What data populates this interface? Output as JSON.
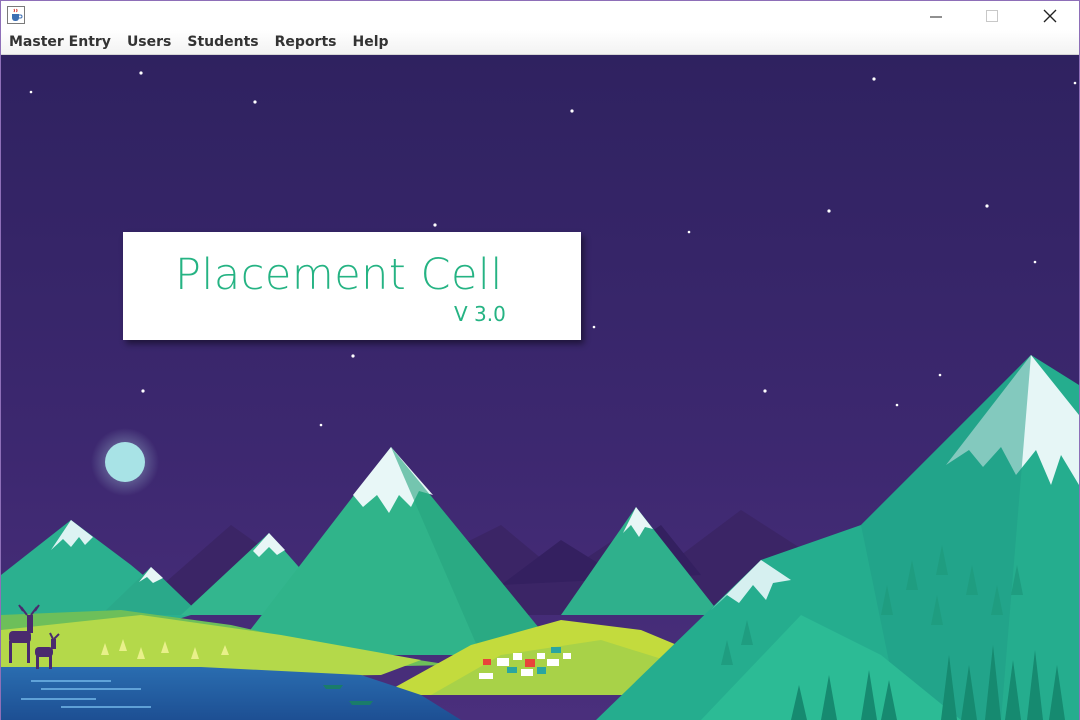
{
  "window": {
    "icon": "java-cup-icon",
    "controls": {
      "minimize": "minimize-icon",
      "maximize": "maximize-icon",
      "close": "close-icon"
    }
  },
  "menubar": {
    "items": [
      {
        "label": "Master Entry"
      },
      {
        "label": "Users"
      },
      {
        "label": "Students"
      },
      {
        "label": "Reports"
      },
      {
        "label": "Help"
      }
    ]
  },
  "splash": {
    "title": "Placement Cell",
    "version": "V 3.0",
    "accent_color": "#25b383",
    "sky_color": "#3a2466"
  }
}
